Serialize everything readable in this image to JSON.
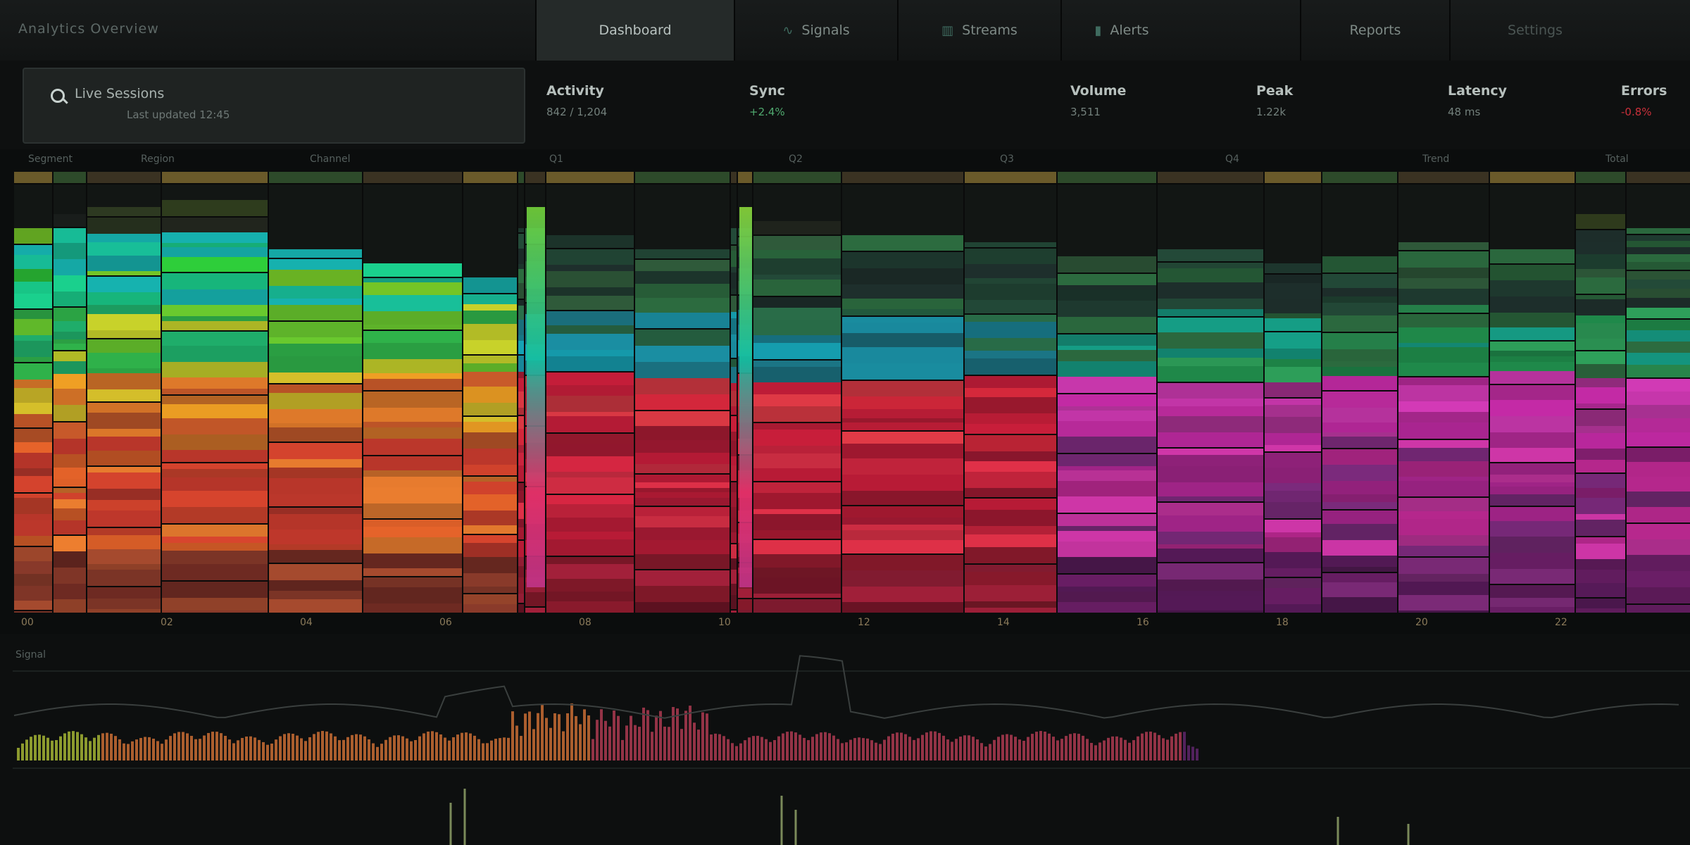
{
  "app": {
    "title": "Analytics Overview",
    "tabs": [
      {
        "label": "Dashboard",
        "icon": "grid-icon",
        "state": "active"
      },
      {
        "label": "Signals",
        "icon": "wave-icon",
        "state": "normal"
      },
      {
        "label": "Streams",
        "icon": "bars-icon",
        "state": "normal"
      },
      {
        "label": "Alerts",
        "icon": "bell-icon",
        "state": "normal"
      },
      {
        "label": "Reports",
        "icon": "",
        "state": "normal"
      },
      {
        "label": "Settings",
        "icon": "",
        "state": "disabled"
      }
    ]
  },
  "search": {
    "title": "Live Sessions",
    "subtitle": "Last updated 12:45"
  },
  "metrics": [
    {
      "label": "Activity",
      "value": "842 / 1,204",
      "trend": "neutral"
    },
    {
      "label": "Sync",
      "value": "+2.4%",
      "trend": "up"
    },
    {
      "label": "Volume",
      "value": "3,511",
      "trend": "neutral"
    },
    {
      "label": "Peak",
      "value": "1.22k",
      "trend": "neutral"
    },
    {
      "label": "Latency",
      "value": "48 ms",
      "trend": "neutral"
    },
    {
      "label": "Errors",
      "value": "-0.8%",
      "trend": "down"
    }
  ],
  "grid_headers": [
    "Segment",
    "Region",
    "Channel",
    "Q1",
    "Q2",
    "Q3",
    "Q4",
    "Trend",
    "Total"
  ],
  "ticks": [
    "00",
    "02",
    "04",
    "06",
    "08",
    "10",
    "12",
    "14",
    "16",
    "18",
    "20",
    "22"
  ],
  "lower_panel": {
    "label": "Signal"
  },
  "colors": {
    "accent": "#4fa86e",
    "negative": "#c9303a",
    "background": "#0b0d0d"
  }
}
